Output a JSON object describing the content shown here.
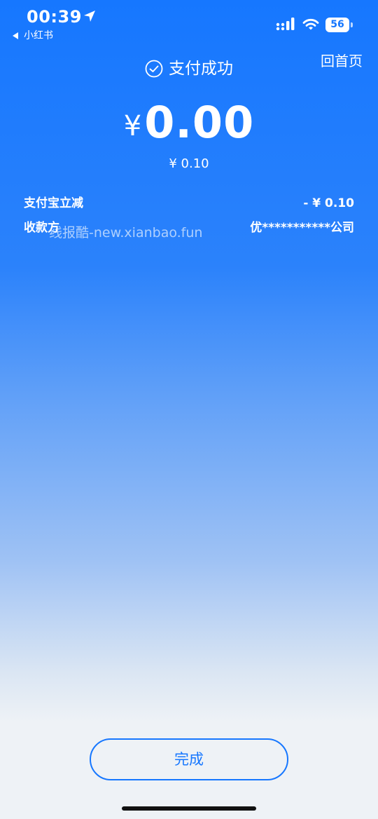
{
  "status_bar": {
    "time": "00:39",
    "back_app": "小红书",
    "battery": "56",
    "icons": [
      "location-arrow-icon",
      "cellular-signal-icon",
      "wifi-icon",
      "battery-icon"
    ]
  },
  "header": {
    "title": "支付成功",
    "home_link": "回首页",
    "title_icon": "check-circle-icon"
  },
  "payment": {
    "currency": "¥",
    "amount": "0.00",
    "original_amount": "¥ 0.10"
  },
  "details": [
    {
      "label": "支付宝立减",
      "value": "- ¥ 0.10"
    },
    {
      "label": "收款方",
      "value": "优***********公司"
    }
  ],
  "watermark": "线报酷-new.xianbao.fun",
  "actions": {
    "done_label": "完成"
  },
  "colors": {
    "brand_blue": "#1677ff",
    "bottom_background": "#eef2f6",
    "text_on_blue": "#ffffff"
  }
}
